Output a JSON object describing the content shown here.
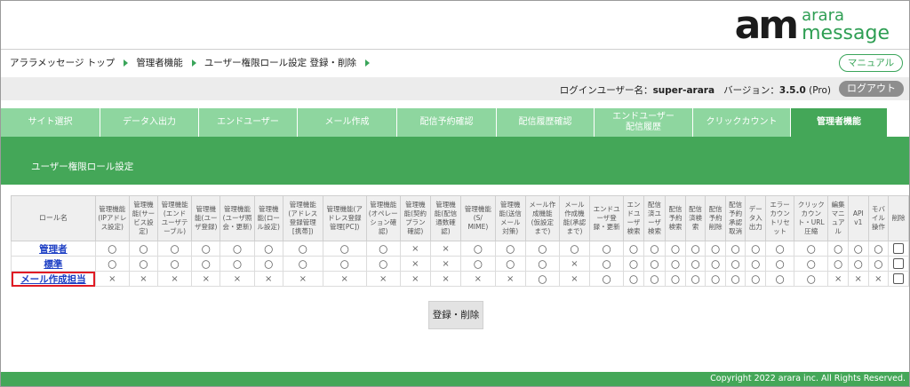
{
  "logo": {
    "mark": "am",
    "line1": "arara",
    "line2": "message"
  },
  "breadcrumb": [
    "アララメッセージ トップ",
    "管理者機能",
    "ユーザー権限ロール設定 登録・削除"
  ],
  "manual_label": "マニュアル",
  "user": {
    "label": "ログインユーザー名：",
    "name": "super-arara",
    "version_label": "バージョン：",
    "version": "3.5.0",
    "edition": "(Pro)"
  },
  "logout_label": "ログアウト",
  "tabs": [
    {
      "label": "サイト選択"
    },
    {
      "label": "データ入出力"
    },
    {
      "label": "エンドユーザー"
    },
    {
      "label": "メール作成"
    },
    {
      "label": "配信予約確認"
    },
    {
      "label": "配信履歴確認"
    },
    {
      "label": "エンドユーザー\n配信履歴"
    },
    {
      "label": "クリックカウント"
    },
    {
      "label": "管理者機能",
      "active": true
    }
  ],
  "panel_title": "ユーザー権限ロール設定",
  "table": {
    "role_header": "ロール名",
    "columns": [
      "管理機能\n(IPアドレ\nス設定)",
      "管理機\n能(サー\nビス設\n定)",
      "管理機能\n(エンド\nユーザテ\nーブル)",
      "管理機\n能(ユー\nザ登録)",
      "管理機能\n(ユーザ照\n会・更新)",
      "管理機\n能(ロー\nル設定)",
      "管理機能\n(アドレス\n登録管理\n[携帯])",
      "管理機能(ア\nドレス登録\n管理[PC])",
      "管理機能\n(オペレー\nション確\n認)",
      "管理機\n能(契約\nプラン\n確認)",
      "管理機\n能(配信\n通数確\n認)",
      "管理機能\n(S/\nMIME)",
      "管理機\n能(送信\nメール\n対策)",
      "メール作\n成機能\n(仮設定\nまで)",
      "メール\n作成機\n能(承認\nまで)",
      "エンドユ\nーザ登\n録・更新",
      "エン\nドユ\nーザ\n検索",
      "配信\n済ユ\nーザ\n検索",
      "配信\n予約\n検索",
      "配信\n済検\n索",
      "配信\n予約\n削除",
      "配信\n予約\n承認\n取消",
      "デー\nタ入\n出力",
      "エラー\nカウン\nトリセ\nット",
      "クリック\nカウン\nト・URL\n圧縮",
      "編集\nマニ\nュア\nル",
      "API\nv1",
      "モバ\nイル\n操作",
      "削除"
    ],
    "rows": [
      {
        "name": "管理者",
        "values": [
          "〇",
          "〇",
          "〇",
          "〇",
          "〇",
          "〇",
          "〇",
          "〇",
          "〇",
          "×",
          "×",
          "〇",
          "〇",
          "〇",
          "〇",
          "〇",
          "〇",
          "〇",
          "〇",
          "〇",
          "〇",
          "〇",
          "〇",
          "〇",
          "〇",
          "〇",
          "〇",
          "〇"
        ]
      },
      {
        "name": "標準",
        "values": [
          "〇",
          "〇",
          "〇",
          "〇",
          "〇",
          "〇",
          "〇",
          "〇",
          "〇",
          "×",
          "×",
          "〇",
          "〇",
          "〇",
          "×",
          "〇",
          "〇",
          "〇",
          "〇",
          "〇",
          "〇",
          "〇",
          "〇",
          "〇",
          "〇",
          "〇",
          "〇",
          "〇"
        ]
      },
      {
        "name": "メール作成担当",
        "highlight": true,
        "values": [
          "×",
          "×",
          "×",
          "×",
          "×",
          "×",
          "×",
          "×",
          "×",
          "×",
          "×",
          "×",
          "×",
          "〇",
          "×",
          "〇",
          "〇",
          "〇",
          "〇",
          "〇",
          "〇",
          "〇",
          "〇",
          "〇",
          "〇",
          "×",
          "×",
          "×"
        ]
      }
    ]
  },
  "submit_label": "登録・削除",
  "footer": "Copyright 2022 arara inc. All Rights Reserved."
}
